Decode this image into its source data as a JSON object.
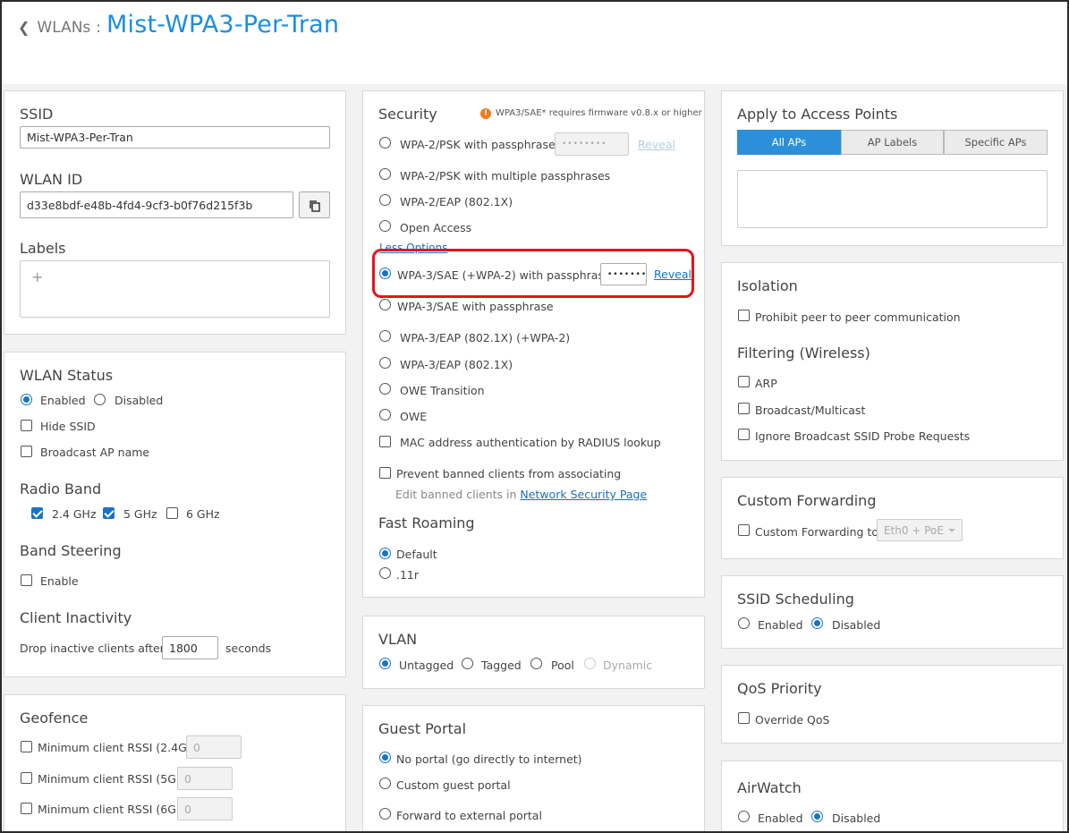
{
  "breadcrumb": {
    "parent": "WLANs",
    "separator": ":",
    "title": "Mist-WPA3-Per-Tran"
  },
  "ssid_card": {
    "ssid_label": "SSID",
    "ssid_value": "Mist-WPA3-Per-Tran",
    "wlan_id_label": "WLAN ID",
    "wlan_id_value": "d33e8bdf-e48b-4fd4-9cf3-b0f76d215f3b",
    "labels_label": "Labels",
    "labels_add": "+"
  },
  "status_card": {
    "title": "WLAN Status",
    "enabled": "Enabled",
    "disabled": "Disabled",
    "hide_ssid": "Hide SSID",
    "broadcast_ap_name": "Broadcast AP name",
    "radio_band_title": "Radio Band",
    "band_24": "2.4 GHz",
    "band_5": "5 GHz",
    "band_6": "6 GHz",
    "band_steering_title": "Band Steering",
    "band_steering_enable": "Enable",
    "client_inactivity_title": "Client Inactivity",
    "drop_label": "Drop inactive clients after",
    "drop_value": "1800",
    "drop_unit": "seconds"
  },
  "geofence": {
    "title": "Geofence",
    "rssi_24": "Minimum client RSSI (2.4G)",
    "rssi_5": "Minimum client RSSI (5G)",
    "rssi_6": "Minimum client RSSI (6G)",
    "value_24": "0",
    "value_5": "0",
    "value_6": "0"
  },
  "security": {
    "title": "Security",
    "notice": "WPA3/SAE* requires firmware v0.8.x or higher",
    "opt_psk": "WPA-2/PSK with passphrase",
    "psk_mask": "••••••••",
    "reveal": "Reveal",
    "opt_multi": "WPA-2/PSK with multiple passphrases",
    "opt_eap": "WPA-2/EAP (802.1X)",
    "opt_open": "Open Access",
    "less_options": "Less Options",
    "opt_wpa3_trans": "WPA-3/SAE (+WPA-2) with passphrase",
    "wpa3_mask": "•••••••",
    "opt_wpa3": "WPA-3/SAE with passphrase",
    "opt_wpa3_eap_trans": "WPA-3/EAP (802.1X) (+WPA-2)",
    "opt_wpa3_eap": "WPA-3/EAP (802.1X)",
    "opt_owe_trans": "OWE Transition",
    "opt_owe": "OWE",
    "mac_auth": "MAC address authentication by RADIUS lookup",
    "prevent_banned": "Prevent banned clients from associating",
    "edit_banned": "Edit banned clients in",
    "network_security_page": "Network Security Page",
    "fast_roaming_title": "Fast Roaming",
    "fr_default": "Default",
    "fr_11r": ".11r"
  },
  "vlan": {
    "title": "VLAN",
    "untagged": "Untagged",
    "tagged": "Tagged",
    "pool": "Pool",
    "dynamic": "Dynamic"
  },
  "guest_portal": {
    "title": "Guest Portal",
    "no_portal": "No portal (go directly to internet)",
    "custom": "Custom guest portal",
    "forward": "Forward to external portal"
  },
  "apply": {
    "title": "Apply to Access Points",
    "tabs": [
      "All APs",
      "AP Labels",
      "Specific APs"
    ]
  },
  "isolation": {
    "title": "Isolation",
    "prohibit": "Prohibit peer to peer communication",
    "filtering_title": "Filtering (Wireless)",
    "arp": "ARP",
    "bcast": "Broadcast/Multicast",
    "ignore_probe": "Ignore Broadcast SSID Probe Requests"
  },
  "custom_forwarding": {
    "title": "Custom Forwarding",
    "label": "Custom Forwarding to",
    "select_value": "Eth0 + PoE"
  },
  "ssid_scheduling": {
    "title": "SSID Scheduling",
    "enabled": "Enabled",
    "disabled": "Disabled"
  },
  "qos": {
    "title": "QoS Priority",
    "override": "Override QoS"
  },
  "airwatch": {
    "title": "AirWatch",
    "enabled": "Enabled",
    "disabled": "Disabled"
  },
  "colors": {
    "accent": "#1c8ee0",
    "highlight": "#e5141b",
    "active_tab": "#2b90d9"
  }
}
